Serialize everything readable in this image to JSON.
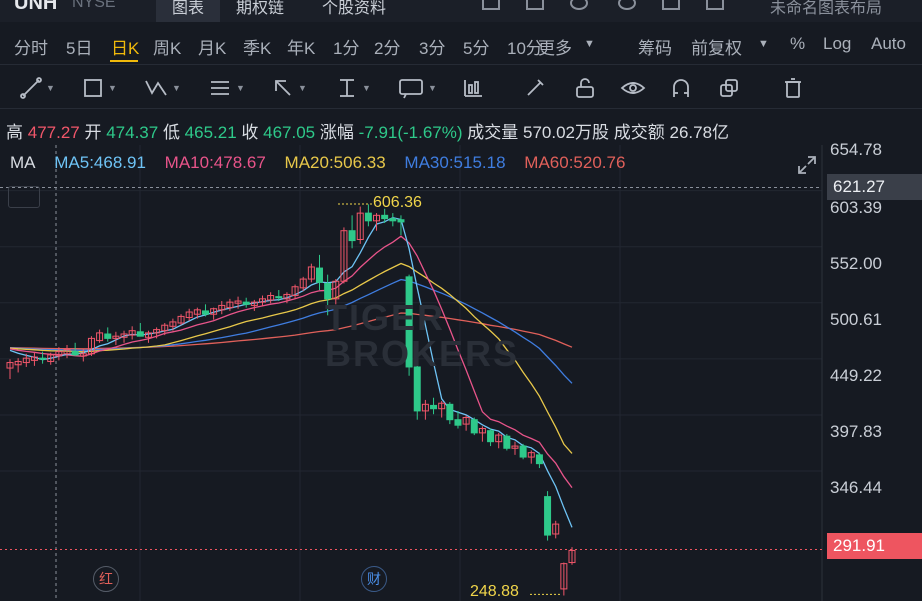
{
  "topbar": {
    "symbol": "UNH",
    "exchange": "NYSE",
    "tabs": [
      "图表",
      "期权链",
      "个股资料"
    ],
    "right_text": "未命名图表布局"
  },
  "periods": {
    "items": [
      "分时",
      "5日",
      "日K",
      "周K",
      "月K",
      "季K",
      "年K",
      "1分",
      "2分",
      "3分",
      "5分",
      "10分"
    ],
    "active": "日K",
    "more": "更多",
    "right_items": [
      "筹码",
      "前复权",
      "%",
      "Log",
      "Auto"
    ]
  },
  "toolbar": {
    "icons": [
      "line-tool-icon",
      "rectangle-tool-icon",
      "polyline-tool-icon",
      "text-list-tool-icon",
      "arrow-tool-icon",
      "vertical-measure-icon",
      "annotation-text-icon",
      "chart-style-icon",
      "pen-icon",
      "lock-icon",
      "eye-icon",
      "magnet-icon",
      "copy-icon",
      "trash-icon"
    ]
  },
  "quote": {
    "high_label": "高",
    "high": "477.27",
    "open_label": "开",
    "open": "474.37",
    "low_label": "低",
    "low": "465.21",
    "close_label": "收",
    "close": "467.05",
    "change_label": "涨幅",
    "change": "-7.91(-1.67%)",
    "volume_label": "成交量",
    "volume": "570.02万股",
    "turnover_label": "成交额",
    "turnover": "26.78亿"
  },
  "ma_legend": {
    "title": "MA",
    "ma5": "MA5:468.91",
    "ma10": "MA10:478.67",
    "ma20": "MA20:506.33",
    "ma30": "MA30:515.18",
    "ma60": "MA60:520.76"
  },
  "colors": {
    "up": "#f0566a",
    "down": "#2ec98a",
    "ma5": "#6ec3f5",
    "ma10": "#e8548a",
    "ma20": "#e8c84a",
    "ma30": "#3f7de0",
    "ma60": "#e0605a",
    "accent": "#f0b90b"
  },
  "y_axis": {
    "labels": [
      "654.78",
      "603.39",
      "552.00",
      "500.61",
      "449.22",
      "397.83",
      "346.44"
    ],
    "crosshair_price": "621.27",
    "last_price": "291.91"
  },
  "annotations": {
    "high": "606.36",
    "low": "248.88"
  },
  "markers": {
    "red": "红",
    "fin": "财"
  },
  "watermark": {
    "line1": "TIGER",
    "line2": "BROKERS"
  },
  "chart_data": {
    "type": "candlestick",
    "ylim": [
      245,
      660
    ],
    "candles": [
      [
        457,
        465,
        447,
        462
      ],
      [
        460,
        466,
        453,
        463
      ],
      [
        462,
        470,
        458,
        466
      ],
      [
        464,
        471,
        459,
        467
      ],
      [
        466,
        472,
        461,
        465
      ],
      [
        463,
        471,
        460,
        469
      ],
      [
        468,
        476,
        464,
        472
      ],
      [
        470,
        478,
        466,
        474
      ],
      [
        472,
        480,
        468,
        469
      ],
      [
        468,
        474,
        463,
        470
      ],
      [
        470,
        486,
        468,
        484
      ],
      [
        482,
        492,
        480,
        489
      ],
      [
        488,
        494,
        481,
        484
      ],
      [
        484,
        490,
        478,
        486
      ],
      [
        485,
        491,
        480,
        488
      ],
      [
        487,
        495,
        483,
        491
      ],
      [
        490,
        498,
        486,
        486
      ],
      [
        485,
        491,
        480,
        489
      ],
      [
        489,
        494,
        484,
        492
      ],
      [
        491,
        498,
        487,
        496
      ],
      [
        495,
        502,
        491,
        499
      ],
      [
        498,
        506,
        496,
        504
      ],
      [
        503,
        511,
        500,
        508
      ],
      [
        506,
        512,
        502,
        510
      ],
      [
        509,
        515,
        504,
        506
      ],
      [
        506,
        512,
        501,
        511
      ],
      [
        510,
        518,
        506,
        514
      ],
      [
        512,
        520,
        509,
        517
      ],
      [
        516,
        522,
        511,
        518
      ],
      [
        517,
        521,
        512,
        515
      ],
      [
        514,
        519,
        509,
        517
      ],
      [
        517,
        523,
        513,
        520
      ],
      [
        519,
        526,
        516,
        523
      ],
      [
        522,
        528,
        518,
        521
      ],
      [
        520,
        526,
        516,
        524
      ],
      [
        523,
        533,
        520,
        531
      ],
      [
        530,
        540,
        527,
        538
      ],
      [
        538,
        552,
        535,
        549
      ],
      [
        548,
        560,
        528,
        535
      ],
      [
        534,
        542,
        505,
        520
      ],
      [
        520,
        538,
        515,
        536
      ],
      [
        536,
        585,
        534,
        582
      ],
      [
        582,
        596,
        566,
        573
      ],
      [
        574,
        604,
        570,
        598
      ],
      [
        598,
        606,
        586,
        591
      ],
      [
        591,
        598,
        582,
        596
      ],
      [
        596,
        602,
        589,
        593
      ],
      [
        593,
        598,
        586,
        591
      ],
      [
        592,
        596,
        578,
        590
      ],
      [
        540,
        542,
        450,
        458
      ],
      [
        458,
        462,
        410,
        418
      ],
      [
        418,
        428,
        410,
        424
      ],
      [
        423,
        430,
        415,
        420
      ],
      [
        420,
        427,
        412,
        425
      ],
      [
        424,
        426,
        406,
        410
      ],
      [
        410,
        418,
        402,
        405
      ],
      [
        406,
        414,
        400,
        412
      ],
      [
        410,
        412,
        396,
        398
      ],
      [
        398,
        404,
        390,
        402
      ],
      [
        400,
        402,
        386,
        390
      ],
      [
        390,
        398,
        384,
        396
      ],
      [
        395,
        397,
        382,
        384
      ],
      [
        384,
        390,
        378,
        386
      ],
      [
        386,
        388,
        374,
        376
      ],
      [
        376,
        382,
        370,
        380
      ],
      [
        378,
        380,
        366,
        370
      ],
      [
        340,
        345,
        300,
        305
      ],
      [
        306,
        318,
        302,
        315
      ],
      [
        256,
        280,
        250,
        279
      ],
      [
        280,
        294,
        278,
        291
      ]
    ]
  }
}
